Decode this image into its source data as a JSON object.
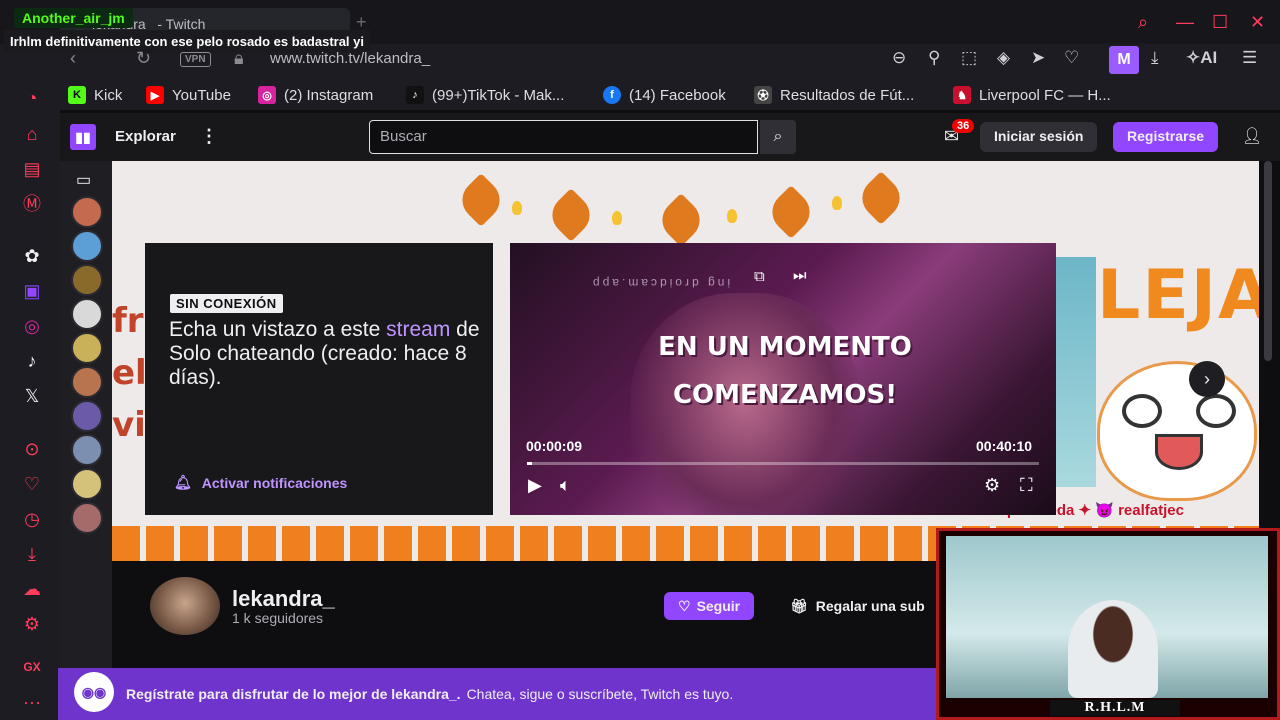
{
  "overlay": {
    "username": "Another_air_jm",
    "chat_message": "Irhlm definitivamente con ese pelo rosado es badastral yi"
  },
  "browser": {
    "tab_title": "lekandra_ - Twitch",
    "vpn_label": "VPN",
    "url": "www.twitch.tv/lekandra_",
    "profile_letter": "M",
    "ai_label": "AI"
  },
  "bookmarks": [
    {
      "label": "Kick",
      "icon": "kick-icon",
      "color": "#53fc18"
    },
    {
      "label": "YouTube",
      "icon": "youtube-icon",
      "color": "#ff0000"
    },
    {
      "label": "(2) Instagram",
      "icon": "instagram-icon",
      "color": "#d6249f"
    },
    {
      "label": "(99+)TikTok - Mak...",
      "icon": "tiktok-icon",
      "color": "#111111"
    },
    {
      "label": "(14) Facebook",
      "icon": "facebook-icon",
      "color": "#1877f2"
    },
    {
      "label": "Resultados de Fút...",
      "icon": "scores-icon",
      "color": "#444444"
    },
    {
      "label": "Liverpool FC — H...",
      "icon": "liverpool-icon",
      "color": "#c8102e"
    }
  ],
  "twitch": {
    "explore_label": "Explorar",
    "search_placeholder": "Buscar",
    "notifications_count": "36",
    "login_label": "Iniciar sesión",
    "signup_label": "Registrarse"
  },
  "offline_card": {
    "badge": "SIN CONEXIÓN",
    "msg_before": "Echa un vistazo a este ",
    "msg_accent": "stream",
    "msg_after": " de Solo chateando (creado: hace 8 días).",
    "notify_label": "Activar notificaciones"
  },
  "video": {
    "watermark": "ing droidcam.app",
    "headline_line1": "EN UN MOMENTO",
    "headline_line2": "COMENZAMOS!",
    "current_time": "00:00:09",
    "duration": "00:40:10",
    "progress_fraction": 0.004
  },
  "banner": {
    "side_text_lines": [
      "fr",
      "el",
      "vi"
    ],
    "big_text": "LEJA",
    "fan_text": "Fan por Moda ✦ 😈 realfatjec"
  },
  "channel": {
    "name": "lekandra_",
    "followers": "1 k seguidores",
    "follow_label": "Seguir",
    "gift_label": "Regalar una sub"
  },
  "promo": {
    "bold_text": "Regístrate para disfrutar de lo mejor de lekandra_.",
    "text": "Chatea, sigue o suscríbete, Twitch es tuyo."
  },
  "webcam": {
    "label": "R.H.L.M"
  }
}
